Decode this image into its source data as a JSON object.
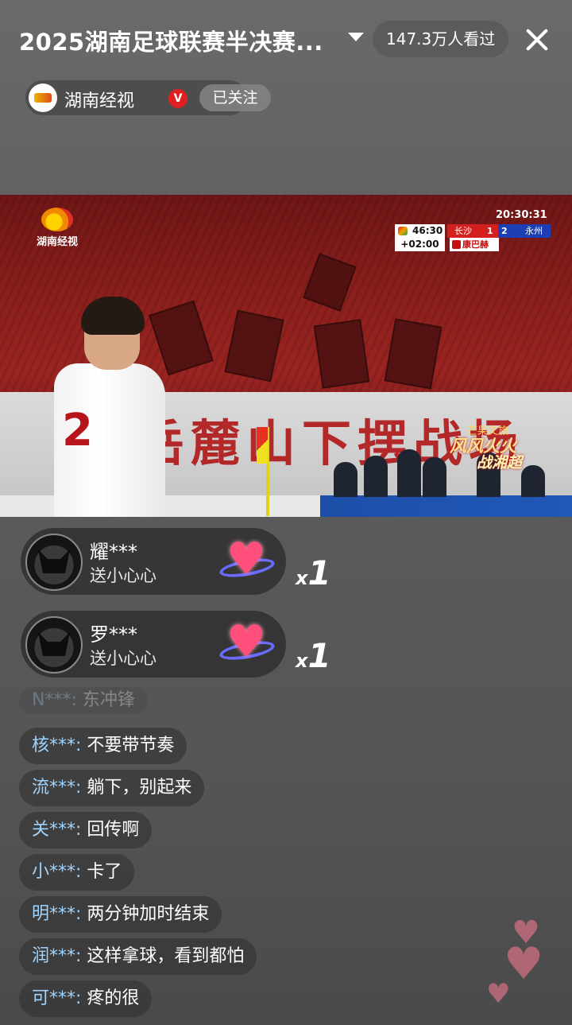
{
  "header": {
    "title": "2025湖南足球联赛半决赛...",
    "viewers": "147.3万人看过"
  },
  "channel": {
    "name": "湖南经视",
    "verified_badge": "V",
    "follow_label": "已关注"
  },
  "video": {
    "broadcaster_logo_text": "湖南经视",
    "clock": "20:30:31",
    "scoreboard": {
      "match_time": "46:30",
      "added_time": "+02:00",
      "home_team": "长沙",
      "home_score": "1",
      "away_score": "2",
      "away_team": "永州",
      "sponsor": "康巴赫",
      "home_color": "#d41f1f",
      "away_color": "#1c3fb4"
    },
    "player_number": "2",
    "banner_text": "岳麓山下摆战场",
    "promo": {
      "line1": "芒果文旅",
      "line2": "风风火火",
      "line3": "战湘超"
    }
  },
  "gifts": [
    {
      "user": "耀***",
      "action": "送小心心",
      "multiplier": "x",
      "count": "1",
      "icon": "heart-gift-icon"
    },
    {
      "user": "罗***",
      "action": "送小心心",
      "multiplier": "x",
      "count": "1",
      "icon": "heart-gift-icon"
    }
  ],
  "chat": [
    {
      "user": "N***:",
      "message": "东冲锋",
      "faded": true
    },
    {
      "user": "核***:",
      "message": "不要带节奏"
    },
    {
      "user": "流***:",
      "message": "躺下，别起来"
    },
    {
      "user": "关***:",
      "message": "回传啊"
    },
    {
      "user": "小***:",
      "message": "卡了"
    },
    {
      "user": "明***:",
      "message": "两分钟加时结束"
    },
    {
      "user": "润***:",
      "message": "这样拿球，看到都怕"
    },
    {
      "user": "可***:",
      "message": "疼的很"
    }
  ]
}
